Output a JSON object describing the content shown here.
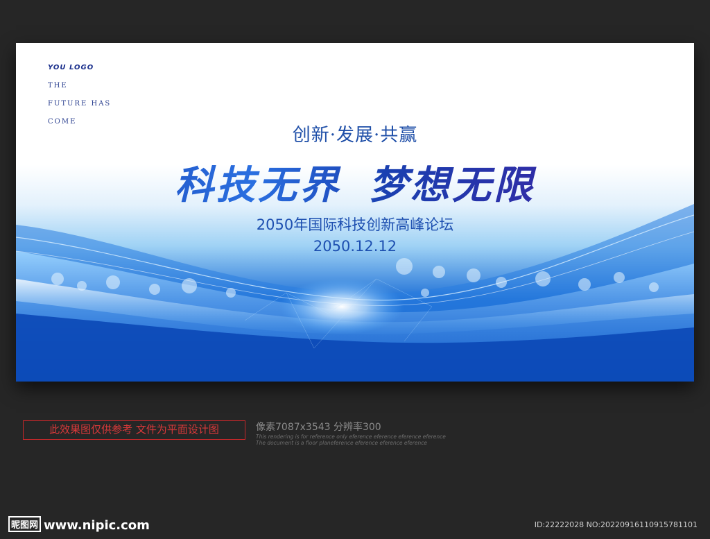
{
  "banner": {
    "logo": "YOU LOGO",
    "tagline_lines": [
      "THE",
      "FUTURE HAS",
      "COME"
    ],
    "slogan": "创新·发展·共赢",
    "headline_left": "科技无界",
    "headline_right": "梦想无限",
    "event_title": "2050年国际科技创新高峰论坛",
    "event_date": "2050.12.12",
    "colors": {
      "primary_blue": "#1d4fb0",
      "deep_blue": "#0a45b4",
      "light_blue": "#9fd2f5"
    }
  },
  "footer": {
    "notice": "此效果图仅供参考 文件为平面设计图",
    "spec": "像素7087x3543  分辨率300",
    "spec_sub_lines": [
      "This rendering is for reference only  eference eference eference eference",
      "The document is a floor planeference eference eference eference"
    ],
    "site_mark": "昵图网",
    "site_url": "www.nipic.com",
    "image_id": "ID:22222028 NO:20220916110915781101"
  }
}
